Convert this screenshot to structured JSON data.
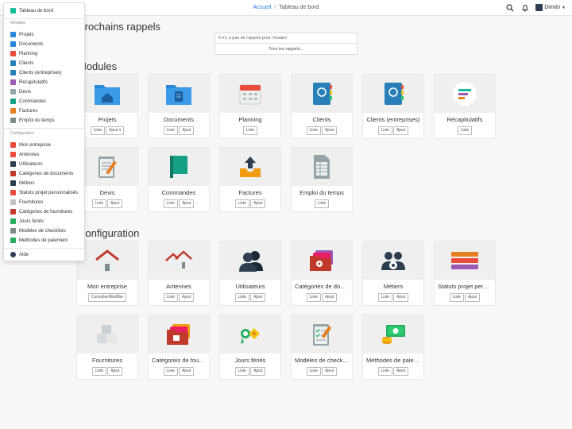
{
  "breadcrumb": {
    "home": "Accueil",
    "current": "Tableau de bord"
  },
  "user": {
    "name": "Dimitri"
  },
  "reminders": {
    "title": "Prochains rappels",
    "empty": "Il n'y a pas de rappels pour l'instant",
    "all": "Tous les rappels..."
  },
  "modules": {
    "title": "Modules",
    "cards": [
      {
        "label": "Projets",
        "buttons": [
          "Liste",
          "Ajout ▾"
        ]
      },
      {
        "label": "Documents",
        "buttons": [
          "Liste",
          "Ajout"
        ]
      },
      {
        "label": "Planning",
        "buttons": [
          "Liste"
        ]
      },
      {
        "label": "Clients",
        "buttons": [
          "Liste",
          "Ajout"
        ]
      },
      {
        "label": "Clients (entreprises)",
        "buttons": [
          "Liste",
          "Ajout"
        ]
      },
      {
        "label": "Récapitulatifs",
        "buttons": [
          "Liste"
        ]
      },
      {
        "label": "Devis",
        "buttons": [
          "Liste",
          "Ajout"
        ]
      },
      {
        "label": "Commandes",
        "buttons": [
          "Liste",
          "Ajout"
        ]
      },
      {
        "label": "Factures",
        "buttons": [
          "Liste",
          "Ajout"
        ]
      },
      {
        "label": "Emploi du temps",
        "buttons": [
          "Liste"
        ]
      }
    ]
  },
  "configuration": {
    "title": "Configuration",
    "cards": [
      {
        "label": "Mon entreprise",
        "buttons": [
          "Consulter/Modifier"
        ]
      },
      {
        "label": "Antennes",
        "buttons": [
          "Liste",
          "Ajout"
        ]
      },
      {
        "label": "Utilisateurs",
        "buttons": [
          "Liste",
          "Ajout"
        ]
      },
      {
        "label": "Catégories de documents",
        "buttons": [
          "Liste",
          "Ajout"
        ]
      },
      {
        "label": "Métiers",
        "buttons": [
          "Liste",
          "Ajout"
        ]
      },
      {
        "label": "Statuts projet personnalisés",
        "buttons": [
          "Liste",
          "Ajout"
        ]
      },
      {
        "label": "Fournitures",
        "buttons": [
          "Liste",
          "Ajout"
        ]
      },
      {
        "label": "Catégories de fournitures",
        "buttons": [
          "Liste",
          "Ajout"
        ]
      },
      {
        "label": "Jours fériés",
        "buttons": [
          "Liste",
          "Ajout"
        ]
      },
      {
        "label": "Modèles de checklists",
        "buttons": [
          "Liste",
          "Ajout"
        ]
      },
      {
        "label": "Méthodes de paiement",
        "buttons": [
          "Liste",
          "Ajout"
        ]
      }
    ]
  },
  "menu": {
    "top": {
      "label": "Tableau de bord",
      "color": "#1abc9c"
    },
    "modules_header": "Modules",
    "modules": [
      {
        "label": "Projets",
        "color": "#2a86d6"
      },
      {
        "label": "Documents",
        "color": "#2a86d6"
      },
      {
        "label": "Planning",
        "color": "#e74c3c"
      },
      {
        "label": "Clients",
        "color": "#2980b9"
      },
      {
        "label": "Clients (entreprises)",
        "color": "#2980b9"
      },
      {
        "label": "Récapitulatifs",
        "color": "#9b59b6"
      },
      {
        "label": "Devis",
        "color": "#95a5a6"
      },
      {
        "label": "Commandes",
        "color": "#16a085"
      },
      {
        "label": "Factures",
        "color": "#e67e22"
      },
      {
        "label": "Emploi du temps",
        "color": "#7f8c8d"
      }
    ],
    "config_header": "Configuration",
    "config": [
      {
        "label": "Mon entreprise",
        "color": "#e74c3c"
      },
      {
        "label": "Antennes",
        "color": "#e74c3c"
      },
      {
        "label": "Utilisateurs",
        "color": "#2c3e50"
      },
      {
        "label": "Catégories de documents",
        "color": "#c0392b"
      },
      {
        "label": "Métiers",
        "color": "#2c3e50"
      },
      {
        "label": "Statuts projet personnalisés",
        "color": "#e74c3c"
      },
      {
        "label": "Fournitures",
        "color": "#bdc3c7"
      },
      {
        "label": "Catégories de fournitures",
        "color": "#c0392b"
      },
      {
        "label": "Jours fériés",
        "color": "#27ae60"
      },
      {
        "label": "Modèles de checklists",
        "color": "#7f8c8d"
      },
      {
        "label": "Méthodes de paiement",
        "color": "#27ae60"
      }
    ],
    "help": {
      "label": "Aide",
      "color": "#2c3e50"
    }
  }
}
